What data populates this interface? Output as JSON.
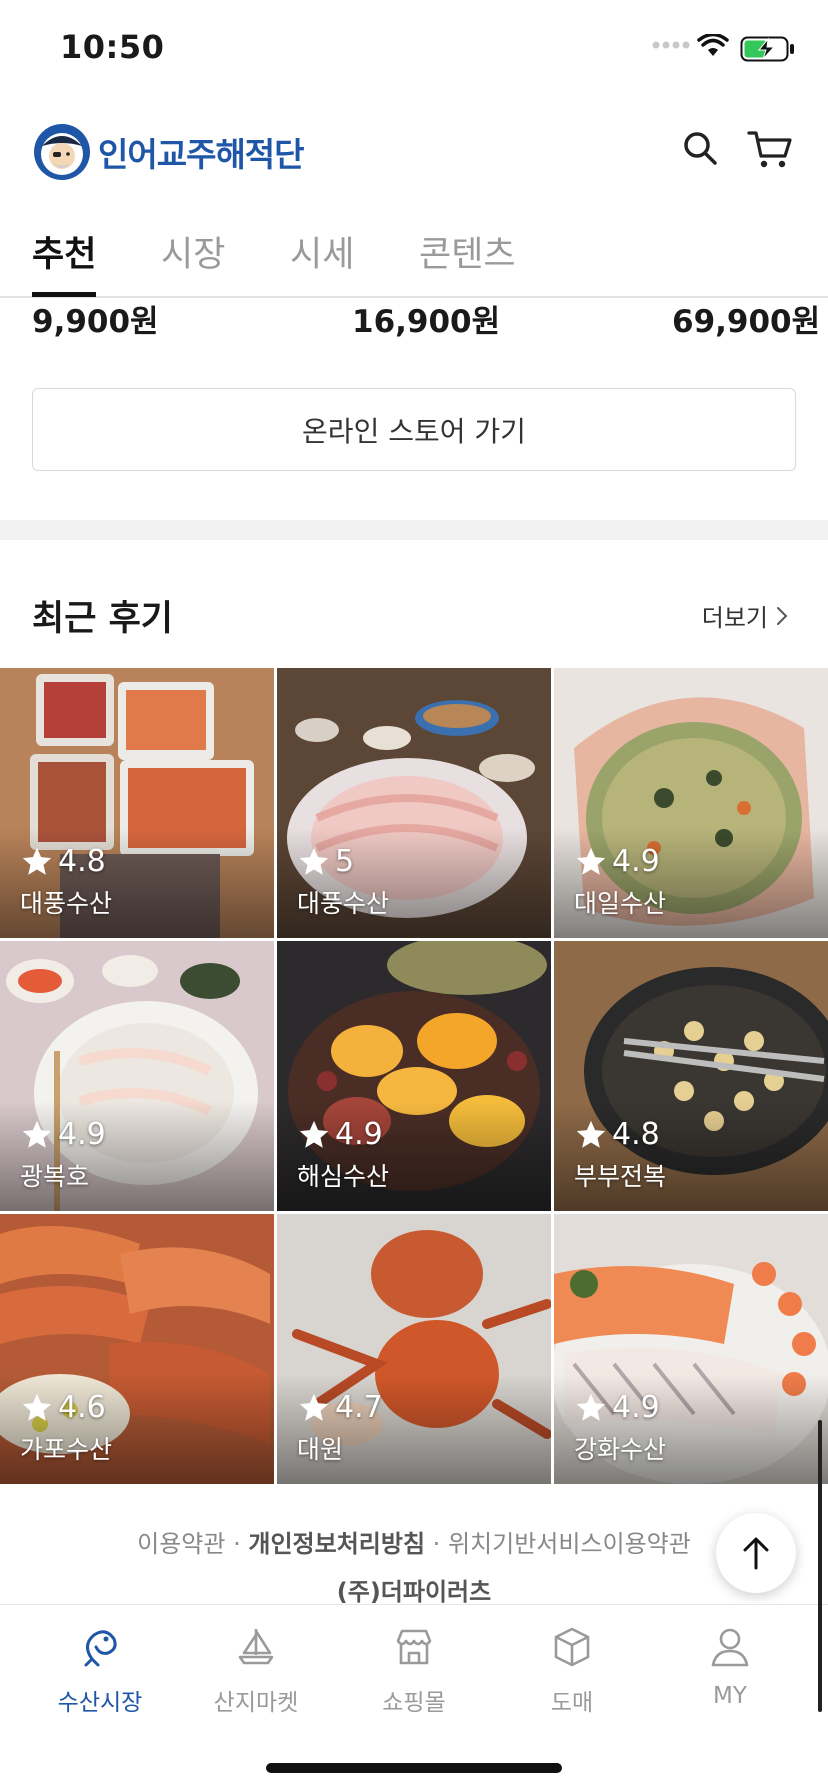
{
  "status_bar": {
    "time": "10:50"
  },
  "header": {
    "brand_name": "인어교주해적단",
    "brand_color": "#1f56a8"
  },
  "main_tabs": [
    {
      "label": "추천",
      "active": true
    },
    {
      "label": "시장",
      "active": false
    },
    {
      "label": "시세",
      "active": false
    },
    {
      "label": "콘텐츠",
      "active": false
    }
  ],
  "prices": [
    "9,900원",
    "16,900원",
    "69,900원"
  ],
  "store_button_label": "온라인 스토어 가기",
  "reviews": {
    "title": "최근 후기",
    "more_label": "더보기",
    "items": [
      {
        "rating": "4.8",
        "store": "대풍수산"
      },
      {
        "rating": "5",
        "store": "대풍수산"
      },
      {
        "rating": "4.9",
        "store": "대일수산"
      },
      {
        "rating": "4.9",
        "store": "광복호"
      },
      {
        "rating": "4.9",
        "store": "해심수산"
      },
      {
        "rating": "4.8",
        "store": "부부전복"
      },
      {
        "rating": "4.6",
        "store": "가포수산"
      },
      {
        "rating": "4.7",
        "store": "대원"
      },
      {
        "rating": "4.9",
        "store": "강화수산"
      }
    ]
  },
  "footer": {
    "links": [
      "이용약관",
      "개인정보처리방침",
      "위치기반서비스이용약관"
    ],
    "separator": "·",
    "company": "(주)더파이러츠"
  },
  "bottom_nav": [
    {
      "label": "수산시장",
      "icon": "fish-hook-icon",
      "active": true
    },
    {
      "label": "산지마켓",
      "icon": "sailboat-icon",
      "active": false
    },
    {
      "label": "쇼핑몰",
      "icon": "storefront-icon",
      "active": false
    },
    {
      "label": "도매",
      "icon": "box-icon",
      "active": false
    },
    {
      "label": "MY",
      "icon": "person-icon",
      "active": false
    }
  ],
  "accent_color": "#1f56a8"
}
